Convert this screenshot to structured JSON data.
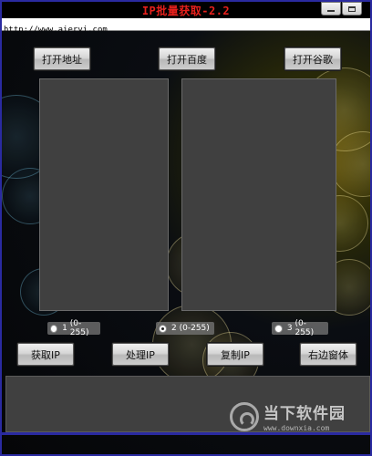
{
  "window": {
    "title": "IP批量获取-2.2",
    "url": "http://www.aieryi.com"
  },
  "top_buttons": [
    {
      "label": "打开地址"
    },
    {
      "label": "打开百度"
    },
    {
      "label": "打开谷歌"
    }
  ],
  "radios": [
    {
      "number": "1",
      "range": "(0-255)",
      "checked": false
    },
    {
      "number": "2",
      "range": "(0-255)",
      "checked": true
    },
    {
      "number": "3",
      "range": "(0-255)",
      "checked": false
    }
  ],
  "bottom_buttons": [
    {
      "label": "获取IP"
    },
    {
      "label": "处理IP"
    },
    {
      "label": "复制IP"
    },
    {
      "label": "右边窗体"
    }
  ],
  "watermark": {
    "brand": "当下软件园",
    "site": "www.downxia.com"
  }
}
